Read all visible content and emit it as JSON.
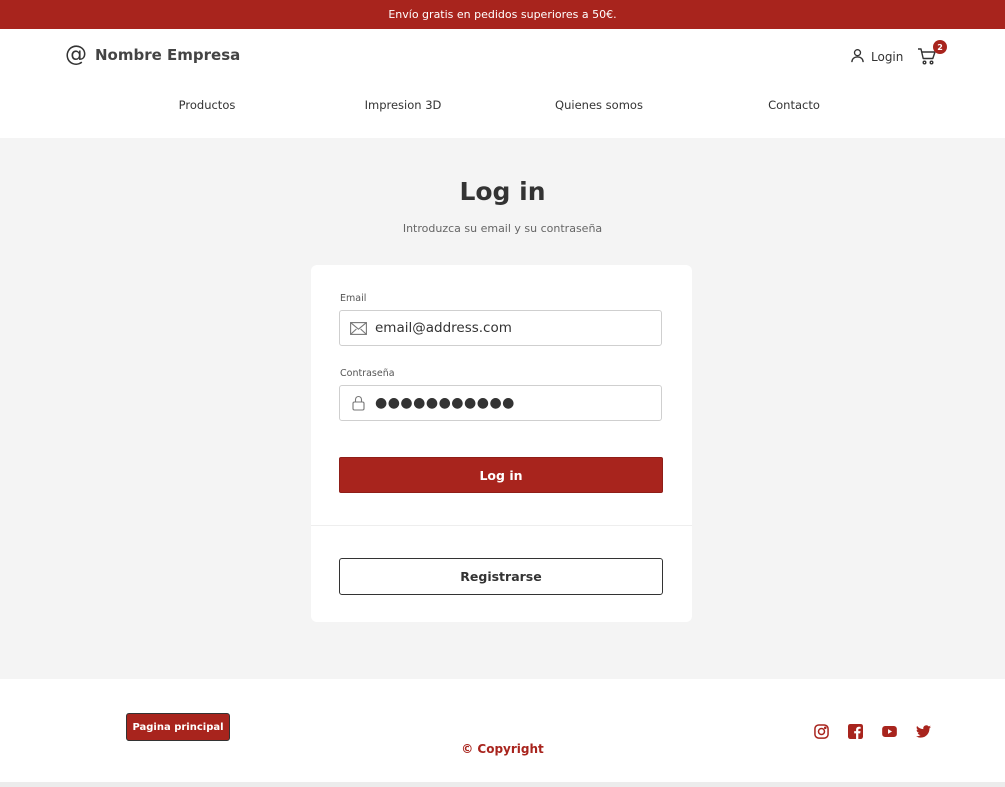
{
  "promo": {
    "text": "Envío gratis en pedidos superiores a 50€."
  },
  "header": {
    "brand_symbol": "@",
    "brand_name": "Nombre Empresa",
    "login_label": "Login",
    "cart_count": "2",
    "icons": {
      "user": "user-icon",
      "cart": "cart-icon"
    }
  },
  "nav": {
    "items": [
      {
        "label": "Productos"
      },
      {
        "label": "Impresion 3D"
      },
      {
        "label": "Quienes somos"
      },
      {
        "label": "Contacto"
      }
    ]
  },
  "main": {
    "title": "Log in",
    "subtitle": "Introduzca su email y su contraseña"
  },
  "form": {
    "email_label": "Email",
    "email_value": "email@address.com",
    "email_icon": "envelope-icon",
    "password_label": "Contraseña",
    "password_value": "●●●●●●●●●●●",
    "password_icon": "lock-icon",
    "login_button": "Log in",
    "register_button": "Registrarse"
  },
  "footer": {
    "home_button": "Pagina principal",
    "copyright": "© Copyright",
    "socials": [
      "instagram-icon",
      "facebook-icon",
      "youtube-icon",
      "twitter-icon"
    ]
  },
  "colors": {
    "accent": "#a8241d",
    "page_background": "#f4f4f4",
    "card_background": "#ffffff",
    "text": "#333333"
  }
}
